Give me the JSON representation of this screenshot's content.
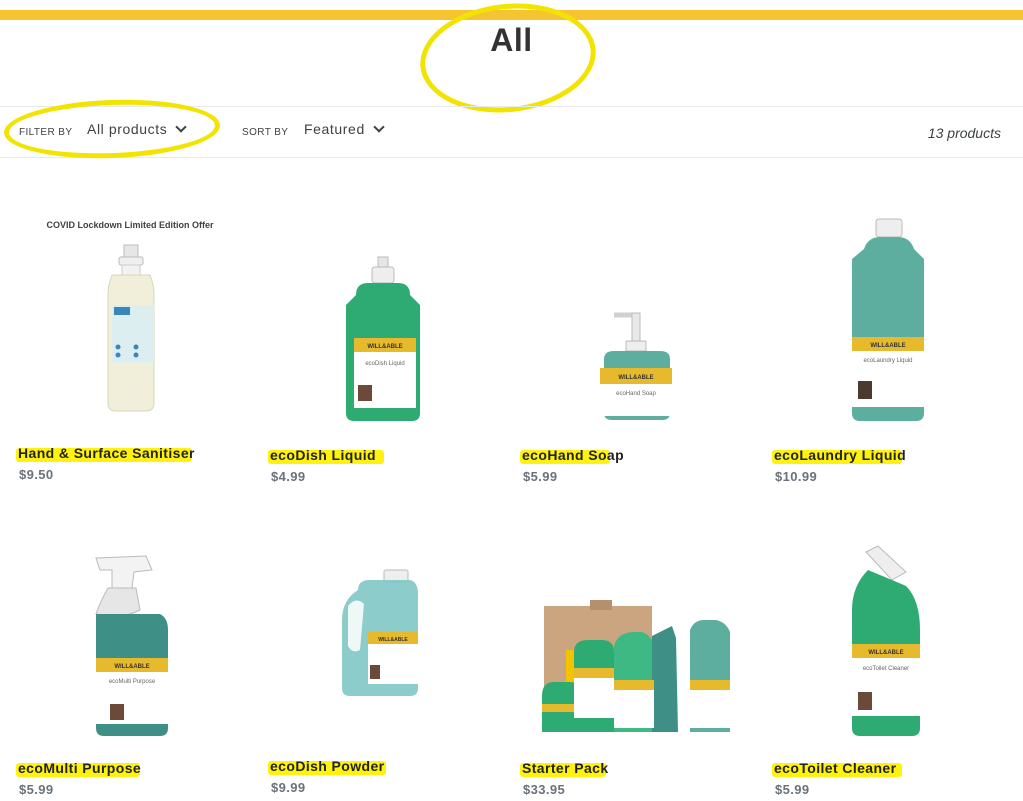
{
  "collection": {
    "title": "All"
  },
  "filterbar": {
    "filter_label": "FILTER BY",
    "filter_value": "All products",
    "sort_label": "SORT BY",
    "sort_value": "Featured",
    "count": "13 products"
  },
  "products": [
    {
      "title": "Hand & Surface Sanitiser",
      "price": "$9.50",
      "promo": "COVID Lockdown Limited Edition Offer",
      "image": "spray-bottle-sanitiser"
    },
    {
      "title": "ecoDish Liquid",
      "price": "$4.99",
      "image": "squeeze-bottle-green",
      "label": "ecoDish Liquid"
    },
    {
      "title": "ecoHand Soap",
      "price": "$5.99",
      "image": "pump-bottle",
      "label": "ecoHand Soap"
    },
    {
      "title": "ecoLaundry Liquid",
      "price": "$10.99",
      "image": "tall-bottle",
      "label": "ecoLaundry Liquid"
    },
    {
      "title": "ecoMulti Purpose",
      "price": "$5.99",
      "image": "trigger-spray-bottle",
      "label": "ecoMulti Purpose"
    },
    {
      "title": "ecoDish Powder",
      "price": "$9.99",
      "image": "jug-bottle"
    },
    {
      "title": "Starter Pack",
      "price": "$33.95",
      "image": "product-group-box"
    },
    {
      "title": "ecoToilet Cleaner",
      "price": "$5.99",
      "image": "toilet-cleaner-bottle",
      "label": "ecoToilet Cleaner"
    }
  ],
  "brand": "WILL&ABLE",
  "colors": {
    "accent_bar": "#f6c431",
    "highlight": "#fff200",
    "label_yellow": "#e7b92d",
    "bottle_green": "#2eaa73",
    "bottle_teal": "#5dae9f"
  }
}
